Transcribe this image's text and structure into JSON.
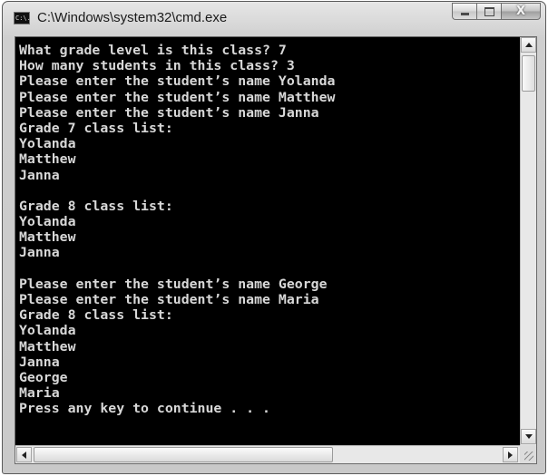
{
  "window": {
    "title": "C:\\Windows\\system32\\cmd.exe",
    "icon": "cmd-icon",
    "icon_text": "C:\\."
  },
  "caption_buttons": {
    "minimize_icon": "minimize-icon",
    "maximize_icon": "maximize-icon",
    "close_icon": "close-icon",
    "close_glyph": "X"
  },
  "console": {
    "text_color": "#d8d8d8",
    "background": "#000000",
    "lines": [
      "What grade level is this class? 7",
      "How many students in this class? 3",
      "Please enter the student’s name Yolanda",
      "Please enter the student’s name Matthew",
      "Please enter the student’s name Janna",
      "Grade 7 class list:",
      "Yolanda",
      "Matthew",
      "Janna",
      "",
      "Grade 8 class list:",
      "Yolanda",
      "Matthew",
      "Janna",
      "",
      "Please enter the student’s name George",
      "Please enter the student’s name Maria",
      "Grade 8 class list:",
      "Yolanda",
      "Matthew",
      "Janna",
      "George",
      "Maria",
      "Press any key to continue . . ."
    ]
  },
  "scrollbars": {
    "vertical_icons": [
      "scroll-up-arrow-icon",
      "scroll-down-arrow-icon"
    ],
    "horizontal_icons": [
      "scroll-left-arrow-icon",
      "scroll-right-arrow-icon"
    ]
  }
}
